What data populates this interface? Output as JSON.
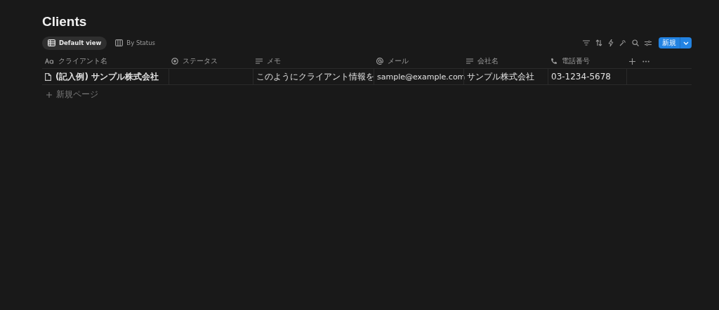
{
  "title": "Clients",
  "tabs": [
    {
      "label": "Default view",
      "kind": "table",
      "selected": true
    },
    {
      "label": "By Status",
      "kind": "board",
      "selected": false
    }
  ],
  "new_button": {
    "label": "新規"
  },
  "columns": [
    {
      "label": "クライアント名",
      "kind": "title"
    },
    {
      "label": "ステータス",
      "kind": "status"
    },
    {
      "label": "メモ",
      "kind": "text"
    },
    {
      "label": "メール",
      "kind": "email"
    },
    {
      "label": "会社名",
      "kind": "text"
    },
    {
      "label": "電話番号",
      "kind": "phone"
    }
  ],
  "rows": [
    {
      "cells": [
        "(記入例) サンプル株式会社",
        "",
        "このようにクライアント情報を",
        "sample@example.com",
        "サンプル株式会社",
        "03-1234-5678"
      ]
    }
  ],
  "new_page": {
    "label": "新規ページ"
  }
}
